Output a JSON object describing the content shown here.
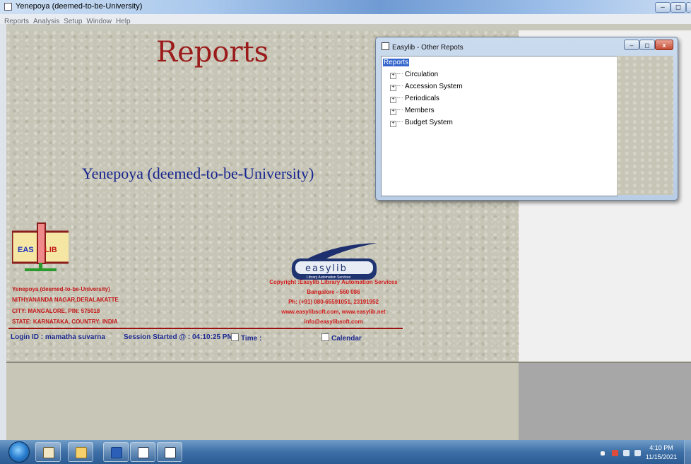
{
  "window": {
    "title": "Yenepoya (deemed-to-be-University)",
    "buttons": {
      "minimize": "–",
      "maximize": "◻",
      "close": "X"
    }
  },
  "menu": [
    "Reports",
    "Analysis",
    "Setup",
    "Window",
    "Help"
  ],
  "main": {
    "heading": "Reports",
    "university": "Yenepoya (deemed-to-be-University)",
    "library_logo": {
      "left": "EAS",
      "right": "LIB"
    },
    "address": [
      "Yenepoya (deemed-to-be-University)",
      "NITHYANANDA NAGAR,DERALAKATTE",
      "CITY: MANGALORE, PIN: 575018",
      "STATE: KARNATAKA, COUNTRY: INDIA"
    ],
    "easylib_logo": {
      "wordmark": "easylib",
      "tagline": "Library Automation Services"
    },
    "copyright": [
      "Copyright :Easylib Library Automation Services",
      "Bangalore - 560 086",
      "Ph: (+91) 080-65591051, 23191952",
      "www.easylibsoft.com, www.easylib.net",
      "info@easylibsoft.com"
    ],
    "status": {
      "login": "Login ID : mamatha suvarna",
      "session": "Session Started @ : 04:10:25 PM",
      "time_label": "Time :",
      "calendar_label": "Calendar"
    }
  },
  "child_window": {
    "title": "Easylib - Other Repots",
    "tree_root": "Reports",
    "tree_items": [
      "Circulation",
      "Accession System",
      "Periodicals",
      "Members",
      "Budget System"
    ]
  },
  "taskbar": {
    "clock_time": "4:10 PM",
    "clock_date": "11/15/2021",
    "apps": [
      "windows-explorer-library",
      "file-explorer",
      "microsoft-word",
      "easylib-app-1",
      "easylib-app-2"
    ]
  },
  "colors": {
    "heading": "#9b1b1b",
    "university": "#17258f",
    "address": "#c31818",
    "status": "#1d2a8f",
    "tree_selection": "#3366cc"
  }
}
